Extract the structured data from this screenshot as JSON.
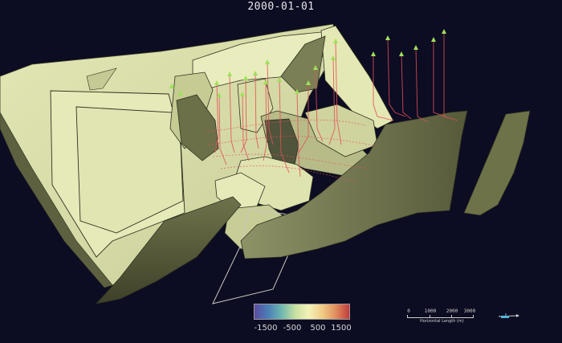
{
  "header": {
    "date": "2000-01-01"
  },
  "colorbar": {
    "ticks": [
      "-1500",
      "-500",
      "500",
      "1500"
    ],
    "colors": [
      "#5b4aa0",
      "#4a7fb5",
      "#6fb7b0",
      "#c6e0a0",
      "#f4f2b8",
      "#f0cc86",
      "#e08e5e",
      "#c23b3b"
    ]
  },
  "scale_bar": {
    "ticks": [
      "0",
      "1000",
      "2000",
      "3000"
    ],
    "title": "Horizontal Length (m)"
  },
  "colors": {
    "background": "#0c0c22",
    "surface_light": "#e4e8b6",
    "surface_mid": "#b9bd8c",
    "surface_dark": "#5a5e3c",
    "well_trace": "#e2505a",
    "well_head": "#9fe05a"
  }
}
